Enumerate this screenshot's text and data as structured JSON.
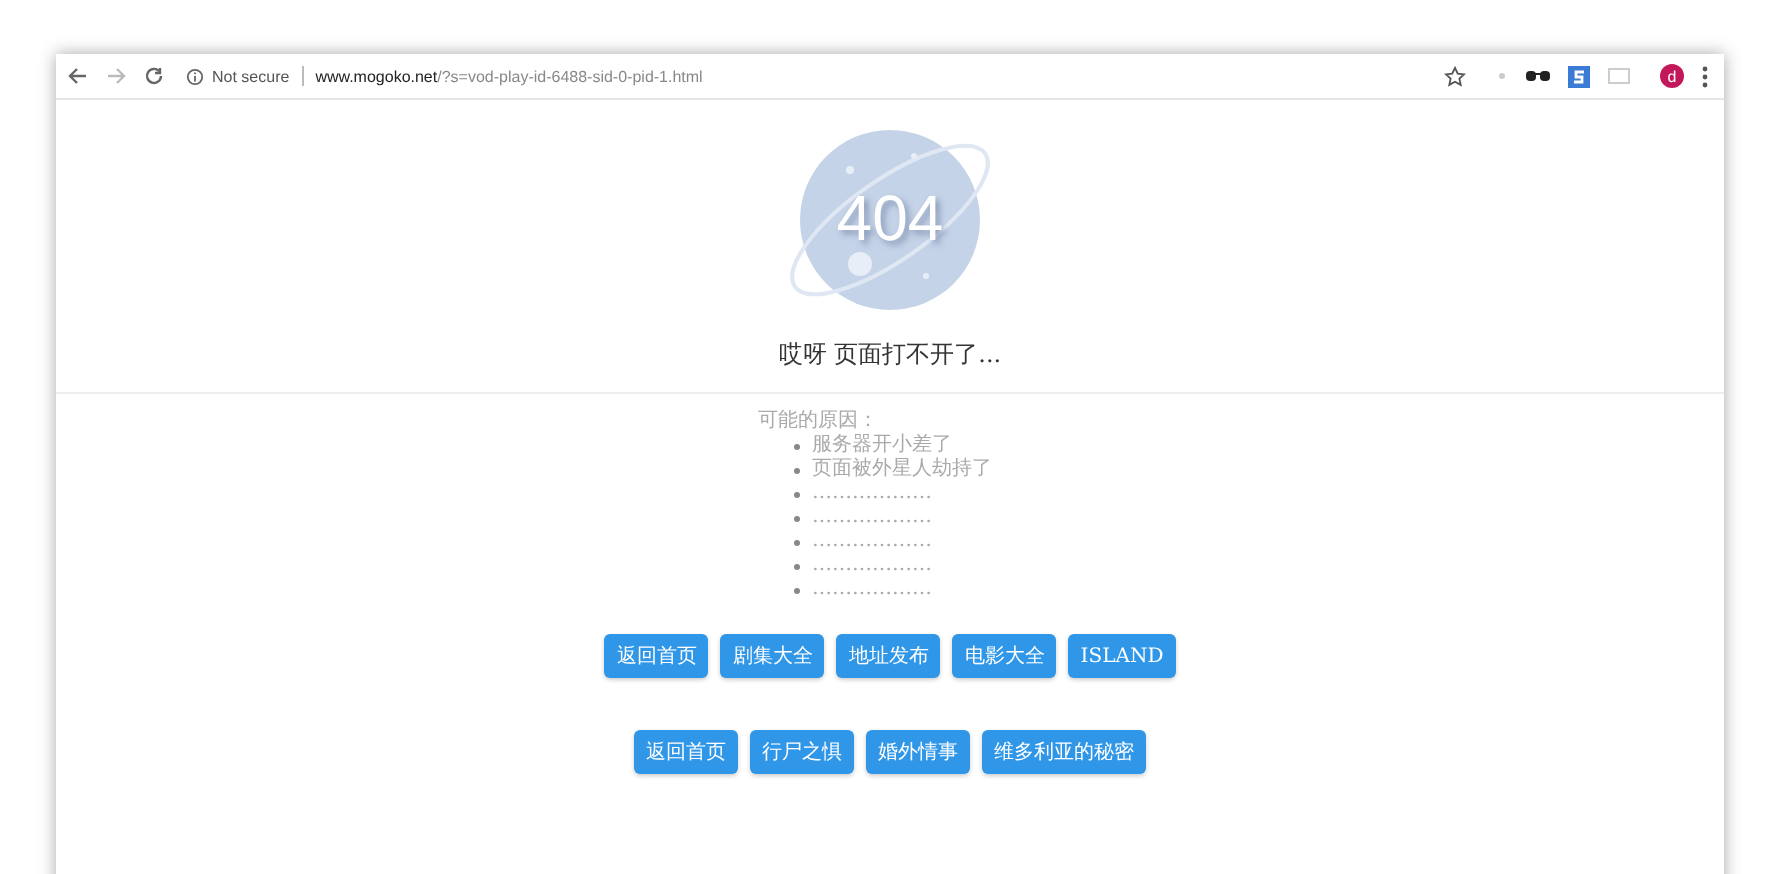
{
  "browser": {
    "security": "Not secure",
    "url": "**www.mogoko.net**/?s=vod-play-id-6488-sid-0-pid-1.html",
    "avatar": "d"
  },
  "error": {
    "code": "404",
    "message": "哎呀 页面打不开了..."
  },
  "reasons": {
    "title": "可能的原因：",
    "items": [
      "服务器开小差了",
      "页面被外星人劫持了",
      "………………",
      "………………",
      "………………",
      "………………",
      "………………"
    ]
  },
  "nav_rows": [
    [
      "返回首页",
      "剧集大全",
      "地址发布",
      "电影大全",
      "ISLAND"
    ],
    [
      "返回首页",
      "行尸之惧",
      "婚外情事",
      "维多利亚的秘密"
    ]
  ]
}
